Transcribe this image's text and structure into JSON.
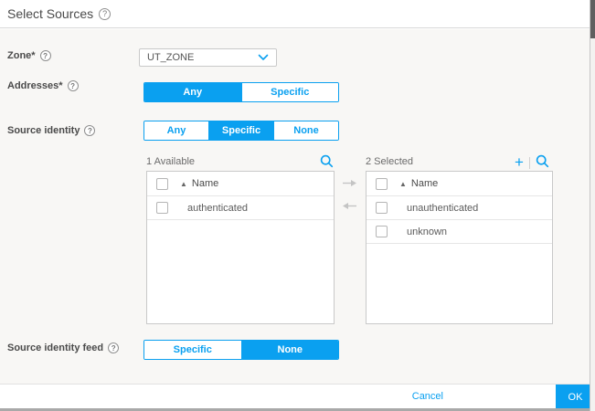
{
  "header": {
    "title": "Select Sources",
    "help_icon": "?"
  },
  "form": {
    "zone": {
      "label": "Zone*",
      "help_icon": "?",
      "value": "UT_ZONE"
    },
    "addresses": {
      "label": "Addresses*",
      "help_icon": "?",
      "options": [
        "Any",
        "Specific"
      ],
      "selected": "Any"
    },
    "source_identity": {
      "label": "Source identity",
      "help_icon": "?",
      "options": [
        "Any",
        "Specific",
        "None"
      ],
      "selected": "Specific"
    },
    "source_identity_feed": {
      "label": "Source identity feed",
      "help_icon": "?",
      "options": [
        "Specific",
        "None"
      ],
      "selected": "None"
    }
  },
  "lists": {
    "available": {
      "title": "1 Available",
      "sort_icon": "▲",
      "column": "Name",
      "rows": [
        "authenticated"
      ]
    },
    "selected": {
      "title": "2 Selected",
      "sort_icon": "▲",
      "column": "Name",
      "rows": [
        "unauthenticated",
        "unknown"
      ],
      "add_icon": "+"
    }
  },
  "footer": {
    "cancel_label": "Cancel",
    "ok_label": "OK"
  },
  "colors": {
    "primary": "#0aa0f0",
    "content_bg": "#f8f7f5"
  }
}
